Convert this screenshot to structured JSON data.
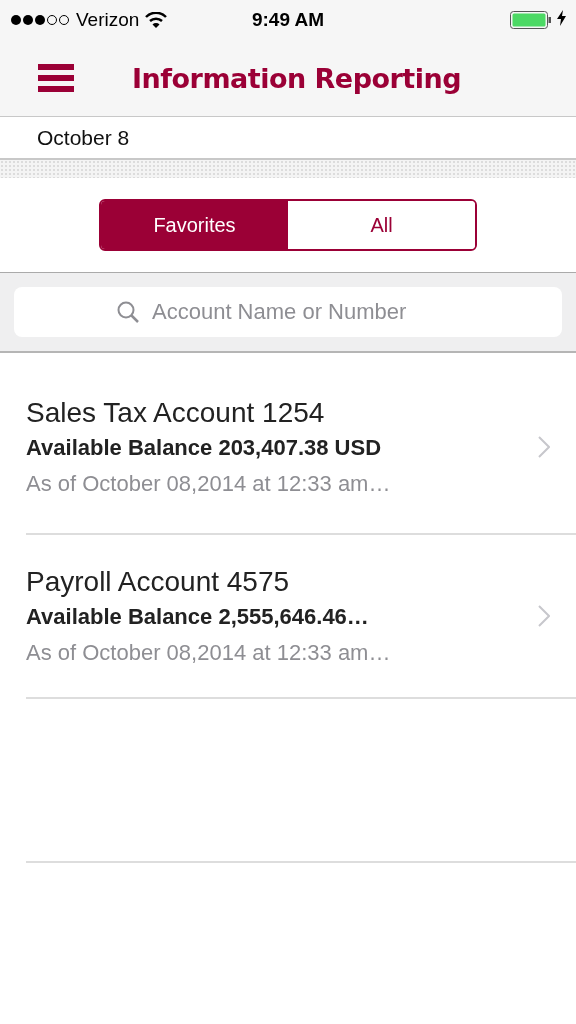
{
  "status_bar": {
    "carrier": "Verizon",
    "time": "9:49 AM",
    "charging": true
  },
  "nav_bar": {
    "title": "Information Reporting"
  },
  "date": "October 8",
  "segments": [
    {
      "label": "Favorites",
      "selected": true
    },
    {
      "label": "All",
      "selected": false
    }
  ],
  "search": {
    "placeholder": "Account Name or Number"
  },
  "accounts": [
    {
      "name": "Sales Tax Account 1254",
      "balance": "Available Balance 203,407.38 USD",
      "as_of": "As of October 08,2014 at 12:33 am…"
    },
    {
      "name": "Payroll Account 4575",
      "balance": "Available Balance 2,555,646.46…",
      "as_of": "As of October 08,2014 at 12:33 am…"
    }
  ]
}
